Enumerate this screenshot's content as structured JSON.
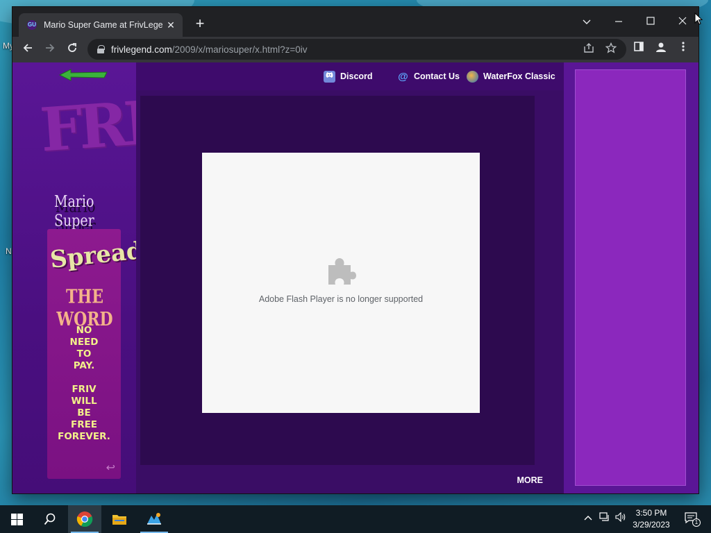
{
  "desktop": {
    "icon_label_partial_1": "My",
    "icon_label_partial_2": "N"
  },
  "browser": {
    "tab": {
      "title": "Mario Super Game at FrivLegend",
      "favicon_text": "GU"
    },
    "address": {
      "host": "frivlegend.com",
      "path": "/2009/x/mariosuper/x.html?z=0iv"
    },
    "icons": {
      "back": "arrow-left-icon",
      "forward": "arrow-right-icon",
      "reload": "reload-icon",
      "share": "share-icon",
      "bookmark": "star-icon",
      "side_panel": "side-panel-icon",
      "profile": "profile-icon",
      "menu": "kebab-menu-icon"
    }
  },
  "page": {
    "top_nav": [
      {
        "label": "Discord",
        "icon": "discord-icon"
      },
      {
        "label": "Contact Us",
        "icon": "at-sign-icon"
      },
      {
        "label": "WaterFox Classic",
        "icon": "waterfox-icon"
      }
    ],
    "left_panel": {
      "logo_text": "FRIV",
      "game_name": "Mario Super",
      "promo": {
        "headline": "Spread",
        "subheadline": "THE WORD",
        "line1": "NO",
        "line2": "NEED",
        "line3": "TO",
        "line4": "PAY.",
        "line5": "FRIV",
        "line6": "WILL",
        "line7": "BE",
        "line8": "FREE",
        "line9": "FOREVER."
      }
    },
    "flash_message": "Adobe Flash Player is no longer supported",
    "more_link": "MORE"
  },
  "taskbar": {
    "time": "3:50 PM",
    "date": "3/29/2023",
    "notification_count": "1"
  },
  "colors": {
    "page_purple": "#4a0f80",
    "frame_dark": "#2d0a4f",
    "ad_purple": "#8b28bd",
    "promo_yellow": "#f3f08a",
    "chrome_dark": "#202124"
  }
}
